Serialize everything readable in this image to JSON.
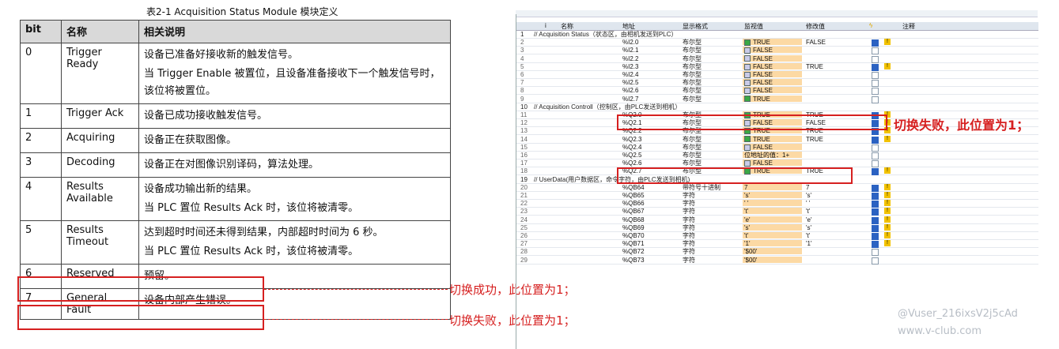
{
  "caption": "表2-1 Acquisition Status Module 模块定义",
  "table": {
    "headers": [
      "bit",
      "名称",
      "相关说明"
    ],
    "rows": [
      {
        "bit": "0",
        "name": "Trigger Ready",
        "desc": [
          "设备已准备好接收新的触发信号。",
          "当 Trigger Enable 被置位，且设备准备接收下一个触发信号时，该位将被置位。"
        ]
      },
      {
        "bit": "1",
        "name": "Trigger Ack",
        "desc": [
          "设备已成功接收触发信号。"
        ]
      },
      {
        "bit": "2",
        "name": "Acquiring",
        "desc": [
          "设备正在获取图像。"
        ]
      },
      {
        "bit": "3",
        "name": "Decoding",
        "desc": [
          "设备正在对图像识别译码，算法处理。"
        ]
      },
      {
        "bit": "4",
        "name": "Results Available",
        "desc": [
          "设备成功输出新的结果。",
          "当 PLC 置位 Results Ack 时，该位将被清零。"
        ]
      },
      {
        "bit": "5",
        "name": "Results Timeout",
        "desc": [
          "达到超时时间还未得到结果，内部超时时间为 6 秒。",
          "当 PLC 置位 Results Ack 时，该位将被清零。"
        ]
      },
      {
        "bit": "6",
        "name": "Reserved",
        "desc": [
          "预留。"
        ]
      },
      {
        "bit": "7",
        "name": "General Fault",
        "desc": [
          "设备内部产生错误。"
        ]
      }
    ]
  },
  "annotations": {
    "success": "切换成功，此位置为1；",
    "fail": "切换失败，此位置为1；",
    "fail_big": "切换失败，此位置为1；"
  },
  "grid": {
    "headers": [
      "i",
      "名称",
      "地址",
      "显示格式",
      "监视值",
      "修改值",
      "注释"
    ],
    "rows": [
      {
        "n": "1",
        "group": "// Acquisition Status（状态区，由相机发送到PLC）"
      },
      {
        "n": "2",
        "addr": "%I2.0",
        "fmt": "布尔型",
        "val": "TRUE",
        "vt": "t",
        "mod": "FALSE",
        "chk": true,
        "warn": true
      },
      {
        "n": "3",
        "addr": "%I2.1",
        "fmt": "布尔型",
        "val": "FALSE",
        "vt": "f"
      },
      {
        "n": "4",
        "addr": "%I2.2",
        "fmt": "布尔型",
        "val": "FALSE",
        "vt": "f"
      },
      {
        "n": "5",
        "addr": "%I2.3",
        "fmt": "布尔型",
        "val": "FALSE",
        "vt": "f",
        "mod": "TRUE",
        "chk": true,
        "warn": true
      },
      {
        "n": "6",
        "addr": "%I2.4",
        "fmt": "布尔型",
        "val": "FALSE",
        "vt": "f"
      },
      {
        "n": "7",
        "addr": "%I2.5",
        "fmt": "布尔型",
        "val": "FALSE",
        "vt": "f"
      },
      {
        "n": "8",
        "addr": "%I2.6",
        "fmt": "布尔型",
        "val": "FALSE",
        "vt": "f"
      },
      {
        "n": "9",
        "addr": "%I2.7",
        "fmt": "布尔型",
        "val": "TRUE",
        "vt": "t"
      },
      {
        "n": "10",
        "group": "// Acquisition Controll（控制区，由PLC发送到相机）"
      },
      {
        "n": "11",
        "addr": "%Q2.0",
        "fmt": "布尔型",
        "val": "TRUE",
        "vt": "t",
        "mod": "TRUE",
        "chk": true,
        "warn": true
      },
      {
        "n": "12",
        "addr": "%Q2.1",
        "fmt": "布尔型",
        "val": "FALSE",
        "vt": "f",
        "mod": "FALSE",
        "chk": true,
        "warn": true
      },
      {
        "n": "13",
        "addr": "%Q2.2",
        "fmt": "布尔型",
        "val": "TRUE",
        "vt": "t",
        "mod": "TRUE",
        "chk": true,
        "warn": true
      },
      {
        "n": "14",
        "addr": "%Q2.3",
        "fmt": "布尔型",
        "val": "TRUE",
        "vt": "t",
        "mod": "TRUE",
        "chk": true,
        "warn": true
      },
      {
        "n": "15",
        "addr": "%Q2.4",
        "fmt": "布尔型",
        "val": "FALSE",
        "vt": "f"
      },
      {
        "n": "16",
        "addr": "%Q2.5",
        "fmt": "布尔型",
        "val": "位地址的值：1+",
        "vt": ""
      },
      {
        "n": "17",
        "addr": "%Q2.6",
        "fmt": "布尔型",
        "val": "FALSE",
        "vt": "f"
      },
      {
        "n": "18",
        "addr": "%Q2.7",
        "fmt": "布尔型",
        "val": "TRUE",
        "vt": "t",
        "mod": "TRUE",
        "chk": true,
        "warn": true
      },
      {
        "n": "19",
        "group": "// UserData(用户数据区，命令字符，由PLC发送到相机)"
      },
      {
        "n": "20",
        "addr": "%QB64",
        "fmt": "带符号十进制",
        "val": "7",
        "vt": "",
        "mod": "7",
        "chk": true,
        "warn": true
      },
      {
        "n": "21",
        "addr": "%QB65",
        "fmt": "字符",
        "val": "'s'",
        "vt": "",
        "mod": "'s'",
        "chk": true,
        "warn": true
      },
      {
        "n": "22",
        "addr": "%QB66",
        "fmt": "字符",
        "val": "' '",
        "vt": "",
        "mod": "' '",
        "chk": true,
        "warn": true
      },
      {
        "n": "23",
        "addr": "%QB67",
        "fmt": "字符",
        "val": "'t'",
        "vt": "",
        "mod": "'t'",
        "chk": true,
        "warn": true
      },
      {
        "n": "24",
        "addr": "%QB68",
        "fmt": "字符",
        "val": "'e'",
        "vt": "",
        "mod": "'e'",
        "chk": true,
        "warn": true
      },
      {
        "n": "25",
        "addr": "%QB69",
        "fmt": "字符",
        "val": "'s'",
        "vt": "",
        "mod": "'s'",
        "chk": true,
        "warn": true
      },
      {
        "n": "26",
        "addr": "%QB70",
        "fmt": "字符",
        "val": "'t'",
        "vt": "",
        "mod": "'t'",
        "chk": true,
        "warn": true
      },
      {
        "n": "27",
        "addr": "%QB71",
        "fmt": "字符",
        "val": "'1'",
        "vt": "",
        "mod": "'1'",
        "chk": true,
        "warn": true
      },
      {
        "n": "28",
        "addr": "%QB72",
        "fmt": "字符",
        "val": "'$00'",
        "vt": ""
      },
      {
        "n": "29",
        "addr": "%QB73",
        "fmt": "字符",
        "val": "'$00'",
        "vt": ""
      }
    ]
  },
  "watermark": [
    "@Vuser_216ixsV2j5cAd",
    "www.v-club.com"
  ]
}
